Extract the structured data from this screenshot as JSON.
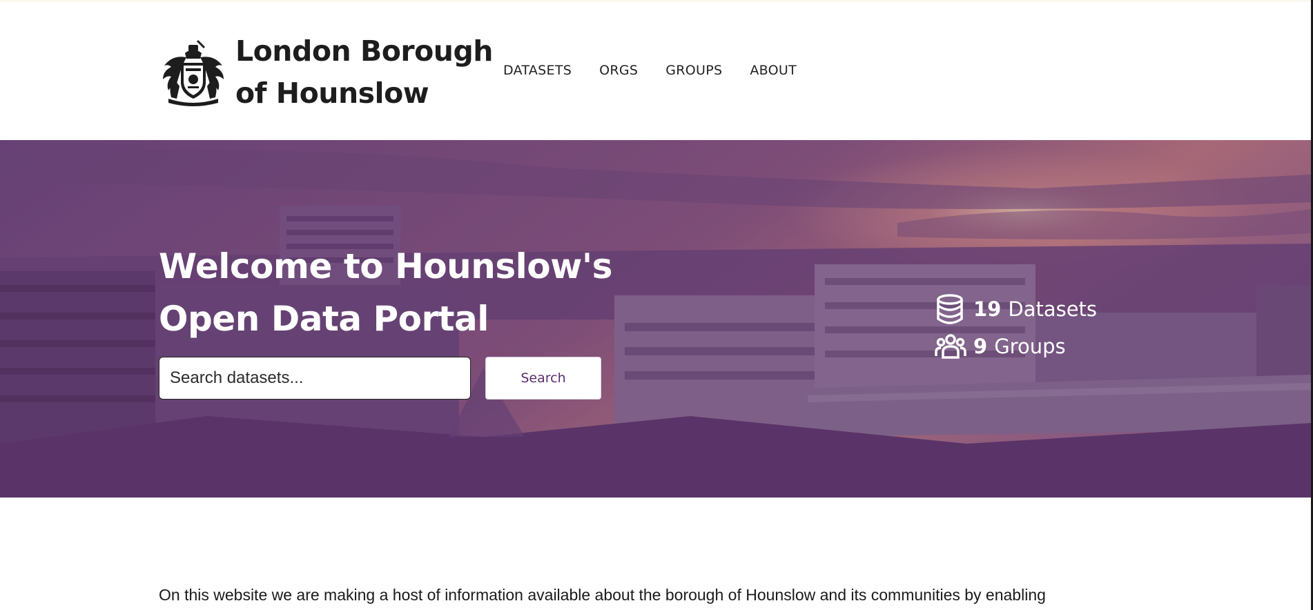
{
  "header": {
    "logo_line1": "London Borough",
    "logo_line2": "of Hounslow",
    "nav": [
      {
        "label": "DATASETS"
      },
      {
        "label": "ORGS"
      },
      {
        "label": "GROUPS"
      },
      {
        "label": "ABOUT"
      }
    ]
  },
  "hero": {
    "title_line1": "Welcome to Hounslow's",
    "title_line2": "Open Data Portal",
    "search_placeholder": "Search datasets...",
    "search_button": "Search",
    "stats": [
      {
        "count": "19",
        "label": "Datasets",
        "icon": "database-icon"
      },
      {
        "count": "9",
        "label": "Groups",
        "icon": "users-group-icon"
      }
    ]
  },
  "intro": {
    "text": "On this website we are making a host of information available about the borough of Hounslow and its communities by enabling"
  },
  "colors": {
    "hero_overlay": "#5b2c6f",
    "search_button_text": "#5b2c6f",
    "text_dark": "#222222"
  }
}
